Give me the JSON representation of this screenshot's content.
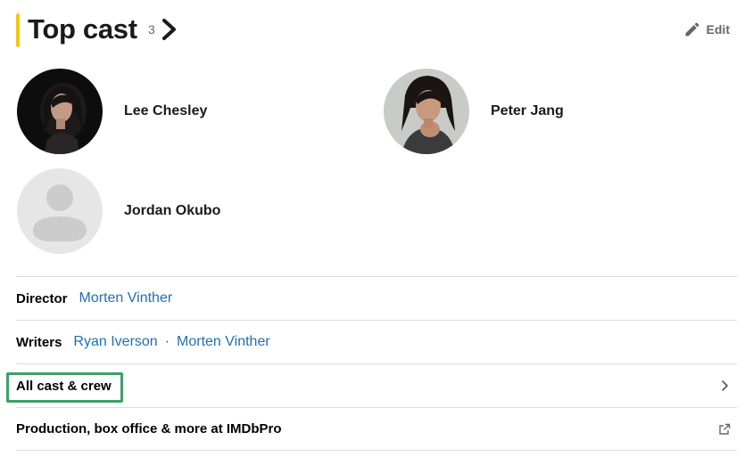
{
  "header": {
    "title": "Top cast",
    "count": "3",
    "edit_label": "Edit"
  },
  "cast": [
    {
      "name": "Lee Chesley",
      "avatar": "photo"
    },
    {
      "name": "Peter Jang",
      "avatar": "photo"
    },
    {
      "name": "Jordan Okubo",
      "avatar": "placeholder-person-icon"
    }
  ],
  "credits": {
    "director_label": "Director",
    "director": "Morten Vinther",
    "writers_label": "Writers",
    "writers": [
      "Ryan Iverson",
      "Morten Vinther"
    ],
    "separator": "·"
  },
  "links": {
    "all_cast": "All cast & crew",
    "imdbpro": "Production, box office & more at IMDbPro"
  },
  "colors": {
    "accent": "#f5c518",
    "link": "#1f6fb5",
    "highlight": "#3da066"
  }
}
